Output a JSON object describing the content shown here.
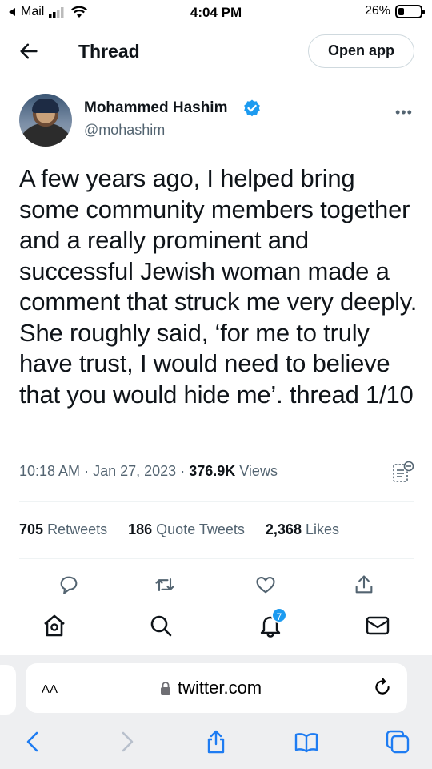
{
  "status_bar": {
    "back_app": "Mail",
    "time": "4:04 PM",
    "battery": "26%",
    "battery_level": 0.26
  },
  "header": {
    "title": "Thread",
    "open_app": "Open app",
    "back_icon": "arrow-left-icon"
  },
  "tweet": {
    "author_name": "Mohammed Hashim",
    "handle": "@mohashim",
    "verified": true,
    "text": "A few years ago, I helped bring some community members together and a really prominent and successful Jewish woman made a comment that struck me very deeply. She roughly said, ‘for me to truly have trust, I would need to believe that you would hide me’. thread 1/10",
    "time": "10:18 AM",
    "date": "Jan 27, 2023",
    "views_count": "376.9K",
    "views_label": "Views",
    "retweets_count": "705",
    "retweets_label": "Retweets",
    "quotes_count": "186",
    "quotes_label": "Quote Tweets",
    "likes_count": "2,368",
    "likes_label": "Likes"
  },
  "actions": [
    "reply-icon",
    "retweet-icon",
    "like-icon",
    "share-icon"
  ],
  "bottom_nav": {
    "items": [
      "home-icon",
      "search-icon",
      "notifications-icon",
      "messages-icon"
    ],
    "notification_badge": "7"
  },
  "safari": {
    "aa": "AA",
    "url": "twitter.com"
  },
  "colors": {
    "accent": "#1d9bf0",
    "text": "#0f1419",
    "secondary": "#536471",
    "divider": "#eff3f4"
  }
}
